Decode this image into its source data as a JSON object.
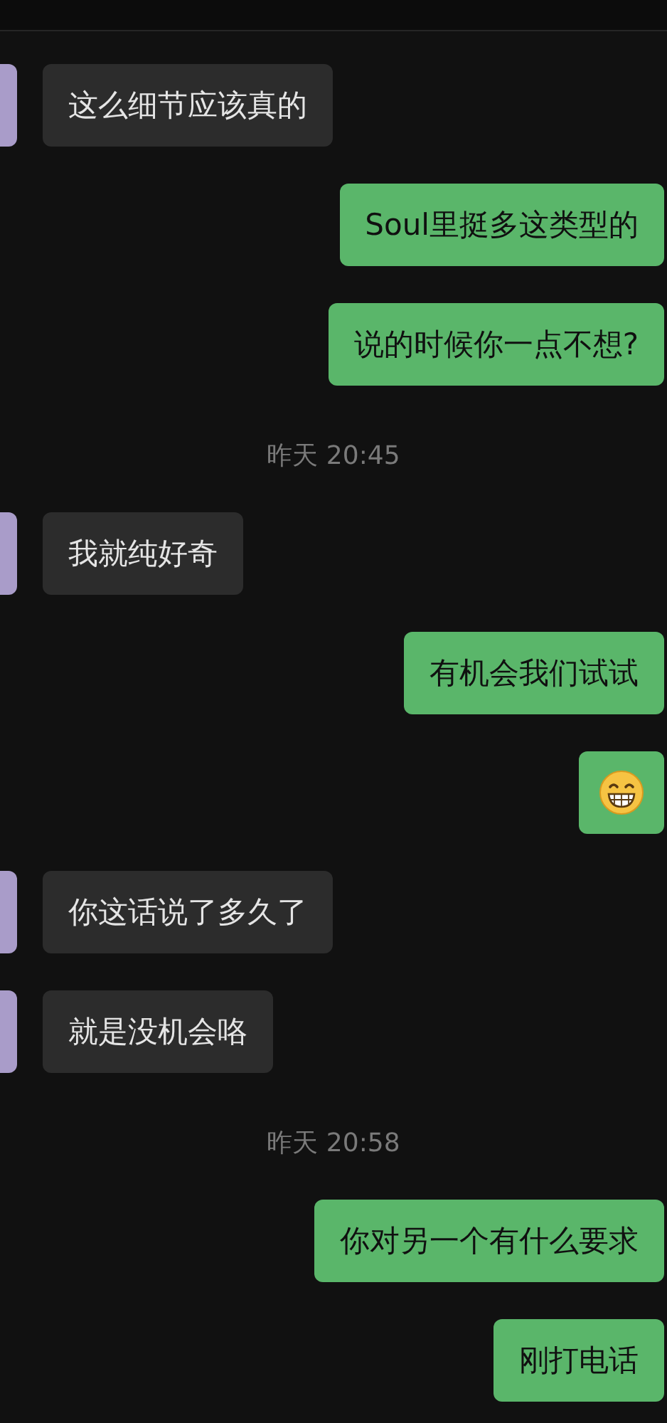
{
  "messages": [
    {
      "kind": "incoming",
      "text": "这么细节应该真的"
    },
    {
      "kind": "outgoing",
      "text": "Soul里挺多这类型的"
    },
    {
      "kind": "outgoing",
      "text": "说的时候你一点不想?"
    },
    {
      "kind": "time",
      "text": "昨天 20:45"
    },
    {
      "kind": "incoming",
      "text": "我就纯好奇"
    },
    {
      "kind": "outgoing",
      "text": "有机会我们试试"
    },
    {
      "kind": "emoji"
    },
    {
      "kind": "incoming",
      "text": "你这话说了多久了"
    },
    {
      "kind": "incoming",
      "text": "就是没机会咯"
    },
    {
      "kind": "time",
      "text": "昨天 20:58"
    },
    {
      "kind": "outgoing",
      "text": "你对另一个有什么要求"
    },
    {
      "kind": "outgoing",
      "text": "刚打电话"
    }
  ]
}
